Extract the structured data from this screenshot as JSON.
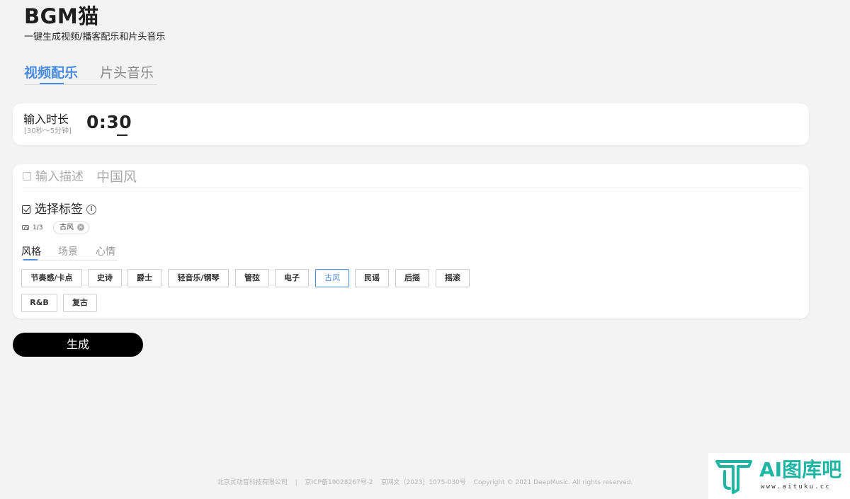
{
  "brand": {
    "title": "BGM猫",
    "subtitle": "一键生成视频/播客配乐和片头音乐"
  },
  "main_tabs": [
    {
      "label": "视频配乐",
      "active": true
    },
    {
      "label": "片头音乐",
      "active": false
    }
  ],
  "duration": {
    "label": "输入时长",
    "hint": "[30秒～5分钟]",
    "value": "0:30"
  },
  "description": {
    "checked": false,
    "label": "输入描述",
    "placeholder": "中国风"
  },
  "tags": {
    "checked": true,
    "label": "选择标签",
    "info_icon": "info-icon",
    "count": "1/3",
    "selected_chip": "古风",
    "sub_tabs": [
      {
        "label": "风格",
        "active": true
      },
      {
        "label": "场景",
        "active": false
      },
      {
        "label": "心情",
        "active": false
      }
    ],
    "items": [
      {
        "label": "节奏感/卡点",
        "selected": false
      },
      {
        "label": "史诗",
        "selected": false
      },
      {
        "label": "爵士",
        "selected": false
      },
      {
        "label": "轻音乐/钢琴",
        "selected": false
      },
      {
        "label": "管弦",
        "selected": false
      },
      {
        "label": "电子",
        "selected": false
      },
      {
        "label": "古风",
        "selected": true
      },
      {
        "label": "民谣",
        "selected": false
      },
      {
        "label": "后摇",
        "selected": false
      },
      {
        "label": "摇滚",
        "selected": false
      },
      {
        "label": "R&B",
        "selected": false
      },
      {
        "label": "复古",
        "selected": false
      }
    ]
  },
  "generate_label": "生成",
  "footer": {
    "company": "北京灵动音科技有限公司",
    "separator": "|",
    "icp": "京ICP备19028267号-2",
    "license": "京网文（2023）1075-030号",
    "copyright": "Copyright © 2021 DeepMusic. All rights reserved."
  },
  "watermark": {
    "text": "AI图库吧",
    "url": "www.aituku.cc"
  },
  "colors": {
    "accent": "#4a8ce0",
    "background": "#f3f3f3",
    "button": "#000000",
    "watermark": "#1fb5a3"
  }
}
